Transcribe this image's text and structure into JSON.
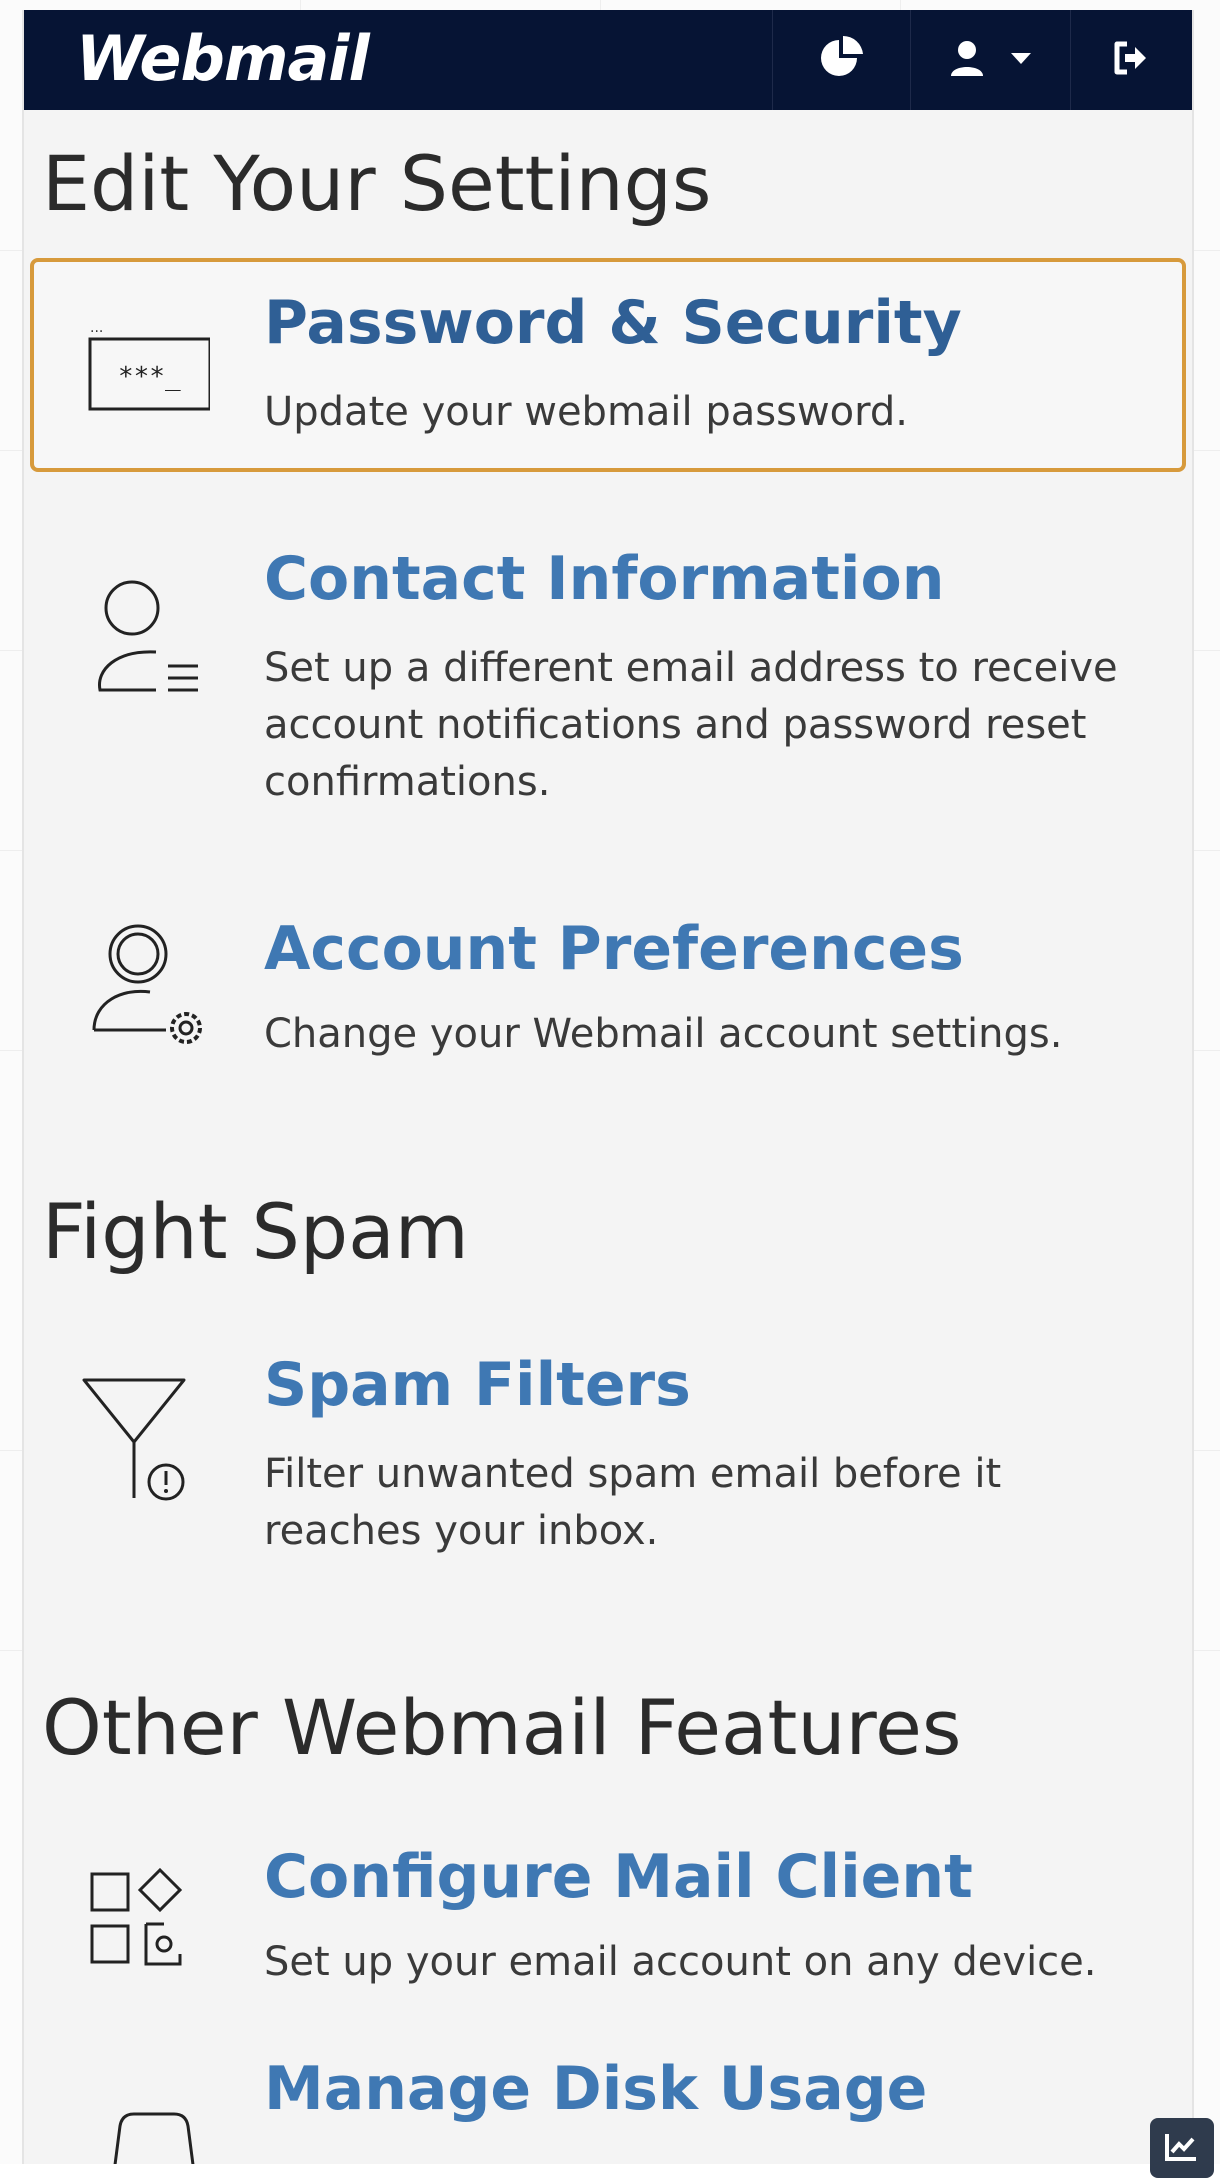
{
  "header": {
    "brand": "Webmail",
    "stats_icon": "pie-chart-icon",
    "user_icon": "user-icon",
    "user_menu_icon": "caret-down-icon",
    "logout_icon": "logout-icon"
  },
  "sections": {
    "settings": {
      "title": "Edit Your Settings",
      "items": [
        {
          "icon": "password-field-icon",
          "title": "Password & Security",
          "description": "Update your webmail password.",
          "selected": true
        },
        {
          "icon": "contact-card-icon",
          "title": "Contact Information",
          "description": "Set up a different email address to receive account notifications and password reset confirmations."
        },
        {
          "icon": "user-gear-icon",
          "title": "Account Preferences",
          "description": "Change your Webmail account settings."
        }
      ]
    },
    "spam": {
      "title": "Fight Spam",
      "items": [
        {
          "icon": "filter-alert-icon",
          "title": "Spam Filters",
          "description": "Filter unwanted spam email before it reaches your inbox."
        }
      ]
    },
    "features": {
      "title": "Other Webmail Features",
      "items": [
        {
          "icon": "devices-grid-icon",
          "title": "Configure Mail Client",
          "description": "Set up your email account on any device."
        },
        {
          "icon": "disk-icon",
          "title": "Manage Disk Usage",
          "description": ""
        }
      ]
    }
  },
  "corner_widget": {
    "icon": "chart-trend-icon"
  },
  "colors": {
    "topbar": "#061434",
    "link": "#3f78b3",
    "selected_border": "#d79a3c",
    "heading": "#2b2b2b",
    "background": "#f4f4f4"
  }
}
